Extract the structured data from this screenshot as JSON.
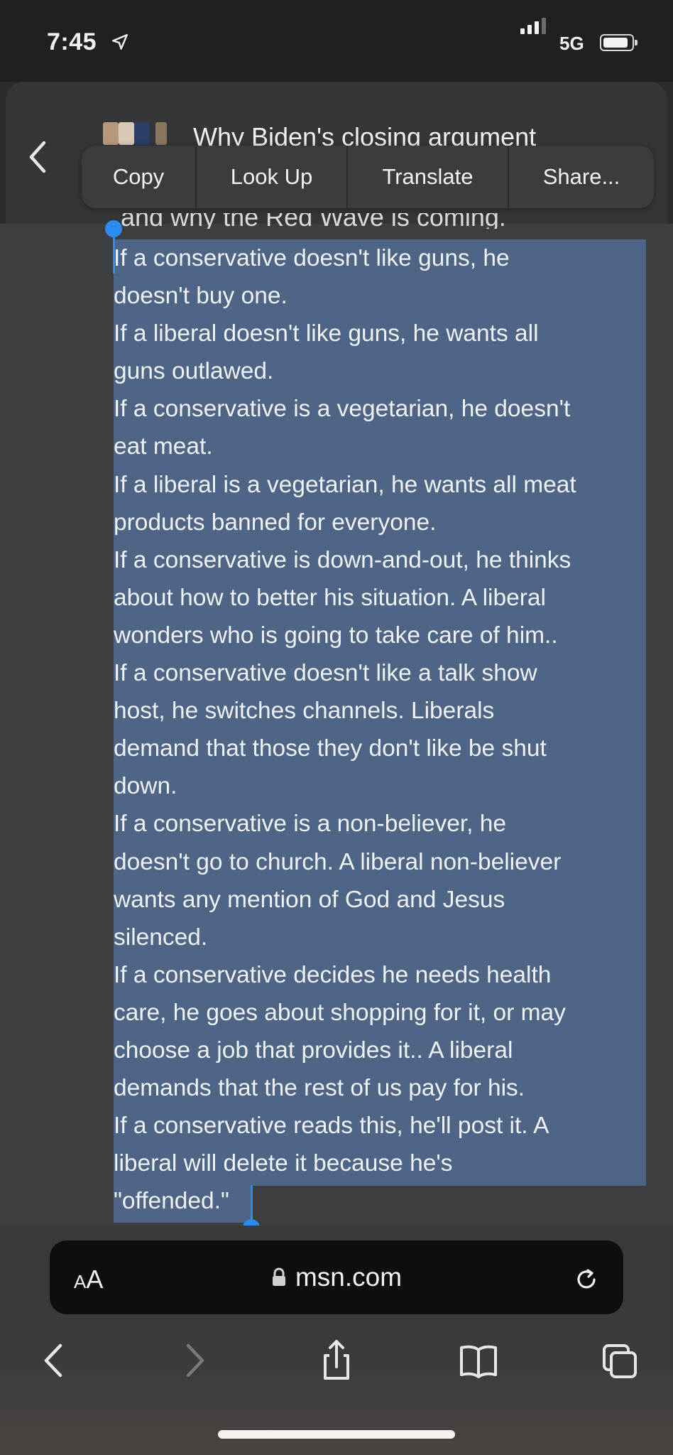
{
  "status_bar": {
    "time": "7:45",
    "network": "5G"
  },
  "header": {
    "title": "Why Biden's closing argument"
  },
  "callout_menu": {
    "items": [
      "Copy",
      "Look Up",
      "Translate",
      "Share..."
    ]
  },
  "article": {
    "cut_off_line": "and why the Red Wave is coming.",
    "lines": [
      "If a conservative doesn't like guns, he",
      "doesn't buy one.",
      "If a liberal doesn't like guns, he wants all",
      "guns outlawed.",
      "If a conservative is a vegetarian, he doesn't",
      "eat meat.",
      "If a liberal is a vegetarian, he wants all meat",
      "products banned for everyone.",
      "If a conservative is down-and-out, he thinks",
      "about how to better his situation. A liberal",
      "wonders who is going to take care of him..",
      "If a conservative doesn't like a talk show",
      "host, he switches channels. Liberals",
      "demand that those they don't like be shut",
      "down.",
      "If a conservative is a non-believer, he",
      "doesn't go to church. A liberal non-believer",
      "wants any mention of God and Jesus",
      "silenced.",
      "If a conservative decides he needs health",
      "care, he goes about shopping for it, or may",
      "choose a job that provides it.. A liberal",
      "demands that the rest of us pay for his.",
      "If a conservative reads this, he'll post it. A",
      "liberal will delete it because he's",
      "\"offended.\""
    ]
  },
  "address_bar": {
    "aa_big": "A",
    "aa_small": "A",
    "url": "msn.com"
  },
  "colors": {
    "selection": "#4e6585",
    "handle": "#2d8cf0"
  },
  "icons": [
    "location-arrow-icon",
    "signal-icon",
    "battery-icon",
    "back-chevron-icon",
    "lock-icon",
    "reload-icon",
    "forward-chevron-icon",
    "share-icon",
    "bookmarks-icon",
    "tabs-icon"
  ]
}
